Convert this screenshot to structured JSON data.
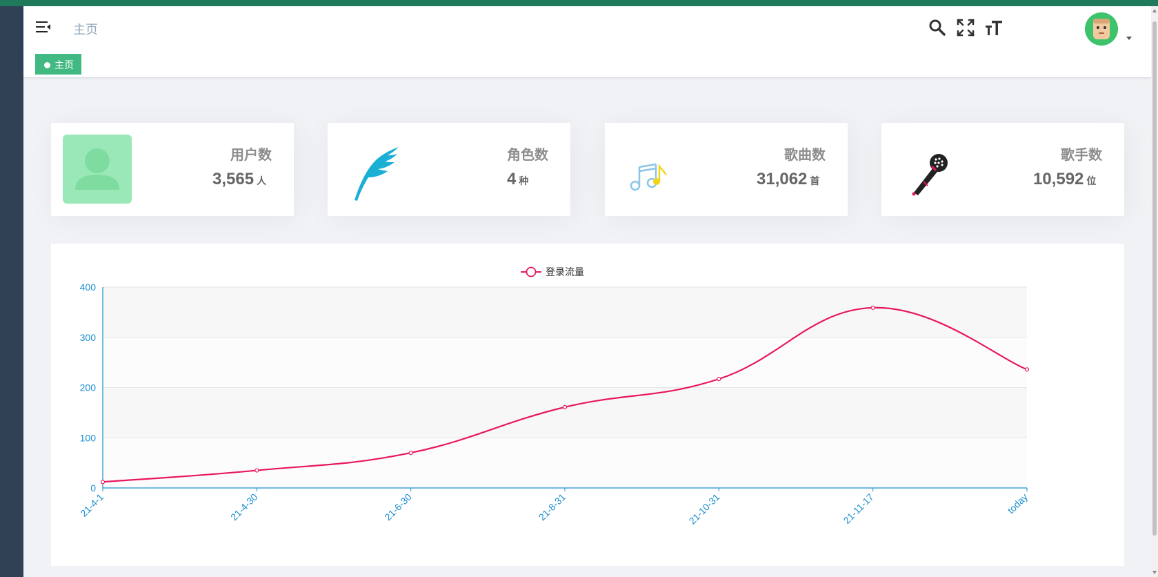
{
  "navbar": {
    "breadcrumb": "主页"
  },
  "tags": [
    {
      "label": "主页",
      "active": true
    }
  ],
  "colors": {
    "accent": "#42b983",
    "sidebar": "#304156",
    "topstrip": "#1f7a5c",
    "chart_line": "#e8175d",
    "axis": "#1a8fd0"
  },
  "cards": [
    {
      "label": "用户数",
      "value": "3,565",
      "unit": "人",
      "icon": "user-icon"
    },
    {
      "label": "角色数",
      "value": "4",
      "unit": "种",
      "icon": "feather-icon"
    },
    {
      "label": "歌曲数",
      "value": "31,062",
      "unit": "首",
      "icon": "music-note-icon"
    },
    {
      "label": "歌手数",
      "value": "10,592",
      "unit": "位",
      "icon": "microphone-icon"
    }
  ],
  "chart_data": {
    "type": "line",
    "legend": "登录流量",
    "legend_position": "top-center",
    "categories": [
      "21-4-1",
      "21-4-30",
      "21-6-30",
      "21-8-31",
      "21-10-31",
      "21-11-17",
      "today"
    ],
    "series": [
      {
        "name": "登录流量",
        "values": [
          12,
          35,
          70,
          161,
          217,
          359,
          236
        ]
      }
    ],
    "ylim": [
      0,
      400
    ],
    "yticks": [
      0,
      100,
      200,
      300,
      400
    ],
    "smooth": true,
    "grid": true
  }
}
